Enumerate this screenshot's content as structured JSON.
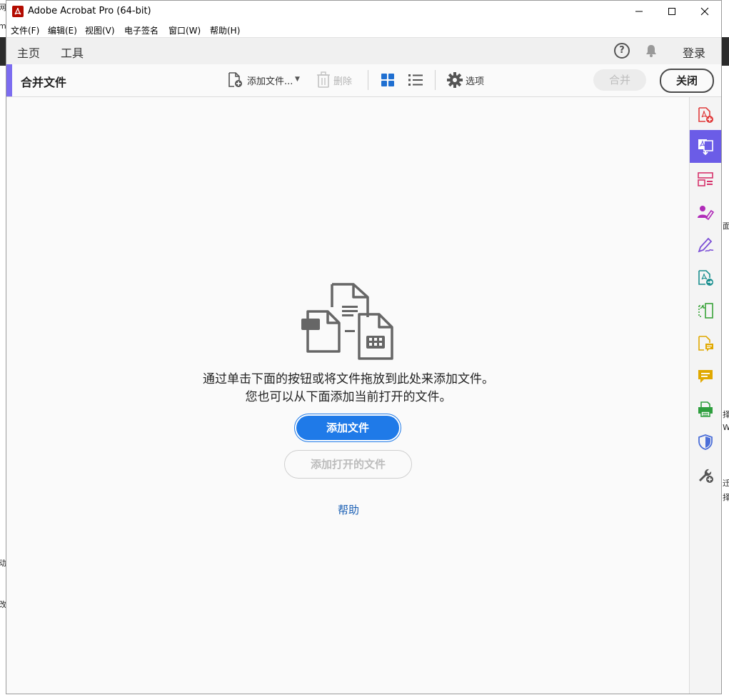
{
  "window": {
    "title": "Adobe Acrobat Pro (64-bit)"
  },
  "menubar": {
    "items": [
      "文件(F)",
      "编辑(E)",
      "视图(V)",
      "电子签名",
      "窗口(W)",
      "帮助(H)"
    ]
  },
  "tabs": {
    "home": "主页",
    "tools": "工具",
    "help_glyph": "?",
    "login": "登录"
  },
  "toolbar": {
    "title": "合并文件",
    "add_files": "添加文件...",
    "delete": "删除",
    "options": "选项",
    "merge": "合并",
    "close": "关闭"
  },
  "main": {
    "message_line1": "通过单击下面的按钮或将文件拖放到此处来添加文件。",
    "message_line2": "您也可以从下面添加当前打开的文件。",
    "add_files_button": "添加文件",
    "add_open_files_button": "添加打开的文件",
    "help_link": "帮助"
  },
  "rightbar": {
    "tools": [
      {
        "icon": "create-pdf-icon",
        "color": "#e03c3c"
      },
      {
        "icon": "combine-files-icon",
        "color": "#ffffff",
        "active": true
      },
      {
        "icon": "organize-pages-icon",
        "color": "#d6336c"
      },
      {
        "icon": "request-signature-icon",
        "color": "#b02bb8"
      },
      {
        "icon": "fill-sign-icon",
        "color": "#7b4fd6"
      },
      {
        "icon": "export-pdf-icon",
        "color": "#1b8f8f"
      },
      {
        "icon": "edit-pdf-icon",
        "color": "#3aa33a"
      },
      {
        "icon": "comment-file-icon",
        "color": "#e0a800"
      },
      {
        "icon": "comment-icon",
        "color": "#e0a800"
      },
      {
        "icon": "print-production-icon",
        "color": "#2e9e3e"
      },
      {
        "icon": "protect-icon",
        "color": "#4c6fd8"
      },
      {
        "icon": "more-tools-icon",
        "color": "#555555"
      }
    ]
  },
  "desktop": {
    "left_texts": [
      "网",
      "m",
      "动",
      "改"
    ],
    "right_texts": [
      "面",
      "择",
      "W",
      "迁",
      "择"
    ]
  }
}
